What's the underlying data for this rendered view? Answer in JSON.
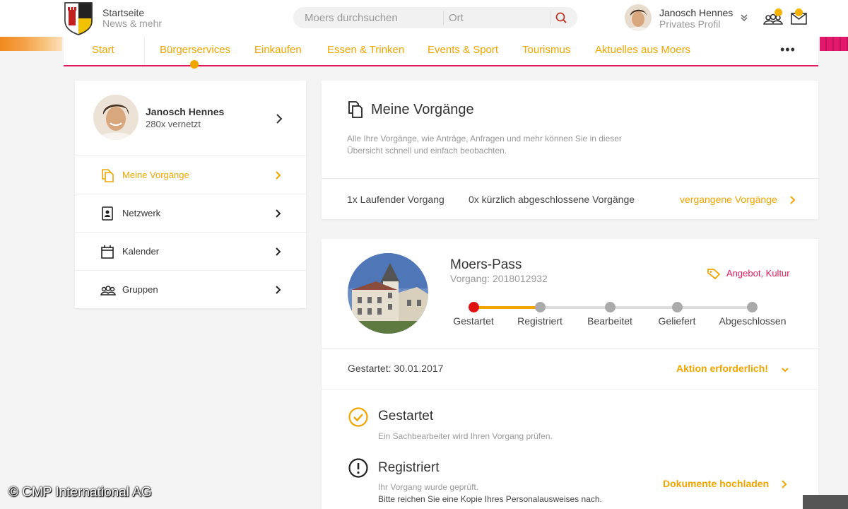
{
  "header": {
    "home_title": "Startseite",
    "home_subtitle": "News & mehr",
    "search": {
      "query_placeholder": "Moers durchsuchen",
      "location_placeholder": "Ort"
    },
    "profile": {
      "name": "Janosch Hennes",
      "subtitle": "Privates Profil"
    },
    "accent_color": "#f0a500",
    "brand_color": "#e2195e"
  },
  "nav": {
    "items": [
      {
        "label": "Start"
      },
      {
        "label": "Bürgerservices"
      },
      {
        "label": "Einkaufen"
      },
      {
        "label": "Essen & Trinken"
      },
      {
        "label": "Events & Sport"
      },
      {
        "label": "Tourismus"
      },
      {
        "label": "Aktuelles aus Moers"
      }
    ],
    "active": "Bürgerservices",
    "more_label": "•••"
  },
  "sidebar": {
    "user": {
      "name": "Janosch Hennes",
      "connections": "280x vernetzt"
    },
    "items": [
      {
        "label": "Meine Vorgänge",
        "icon": "documents-icon",
        "active": true
      },
      {
        "label": "Netzwerk",
        "icon": "contacts-icon",
        "active": false
      },
      {
        "label": "Kalender",
        "icon": "calendar-icon",
        "active": false
      },
      {
        "label": "Gruppen",
        "icon": "groups-icon",
        "active": false
      }
    ]
  },
  "overview": {
    "title": "Meine Vorgänge",
    "description": "Alle Ihre Vorgänge, wie Anträge, Anfragen und mehr können Sie in dieser Übersicht schnell und einfach beobachten.",
    "running": "1x Laufender Vorgang",
    "recently_closed": "0x kürzlich abgeschlossene Vorgänge",
    "past_link": "vergangene Vorgänge"
  },
  "process": {
    "title": "Moers-Pass",
    "reference": "Vorgang: 2018012932",
    "tags": "Angebot, Kultur",
    "steps": [
      "Gestartet",
      "Registriert",
      "Bearbeitet",
      "Geliefert",
      "Abgeschlossen"
    ],
    "current_step": 1,
    "started": "Gestartet: 30.01.2017",
    "action_required": "Aktion erforderlich!",
    "log": [
      {
        "title": "Gestartet",
        "icon": "check-circle-icon",
        "description": "Ein Sachbearbeiter wird Ihren Vorgang prüfen."
      },
      {
        "title": "Registriert",
        "icon": "exclamation-circle-icon",
        "description": "Ihr Vorgang wurde geprüft.",
        "instruction": "Bitte reichen Sie eine Kopie Ihres Personalausweises nach."
      }
    ],
    "upload_link": "Dokumente hochladen"
  },
  "watermark": "© CMP International AG"
}
